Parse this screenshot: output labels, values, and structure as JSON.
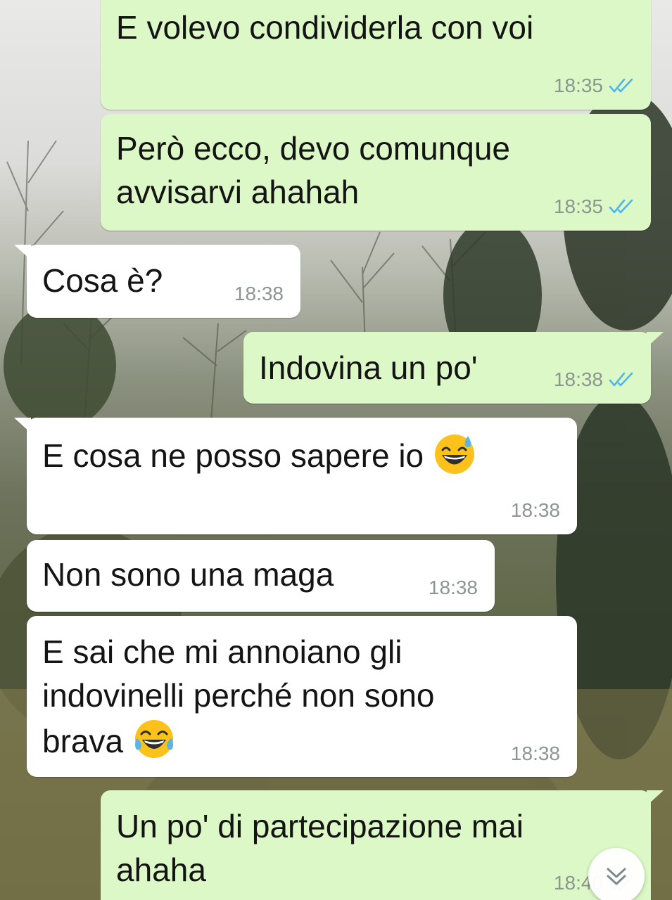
{
  "chat": {
    "messages": [
      {
        "direction": "out",
        "text": "E volevo condividerla con voi",
        "time": "18:35",
        "status": "read"
      },
      {
        "direction": "out",
        "lines": [
          "Però ecco, devo comunque",
          "avvisarvi ahahah"
        ],
        "time": "18:35",
        "status": "read"
      },
      {
        "direction": "in",
        "text": "Cosa è?",
        "time": "18:38"
      },
      {
        "direction": "out",
        "text": "Indovina un po'",
        "time": "18:38",
        "status": "read"
      },
      {
        "direction": "in",
        "text": "E cosa ne posso sapere io",
        "emoji": "grinning-face-with-sweat-emoji",
        "time": "18:38"
      },
      {
        "direction": "in",
        "text": "Non sono una maga",
        "time": "18:38"
      },
      {
        "direction": "in",
        "lines": [
          "E sai che mi annoiano gli",
          "indovinelli perché non sono",
          "brava"
        ],
        "emoji": "face-with-tears-of-joy-emoji",
        "time": "18:38"
      },
      {
        "direction": "out",
        "lines": [
          "Un po' di partecipazione mai",
          "ahaha"
        ],
        "time": "18:40",
        "status": "read"
      }
    ]
  },
  "icons": {
    "read_ticks": "double-check-icon",
    "scroll_down": "double-chevron-down-icon"
  },
  "colors": {
    "outgoing_bubble": "#dcf8c6",
    "incoming_bubble": "#ffffff",
    "read_ticks": "#4fb6ec",
    "timestamp": "#8c9690"
  }
}
